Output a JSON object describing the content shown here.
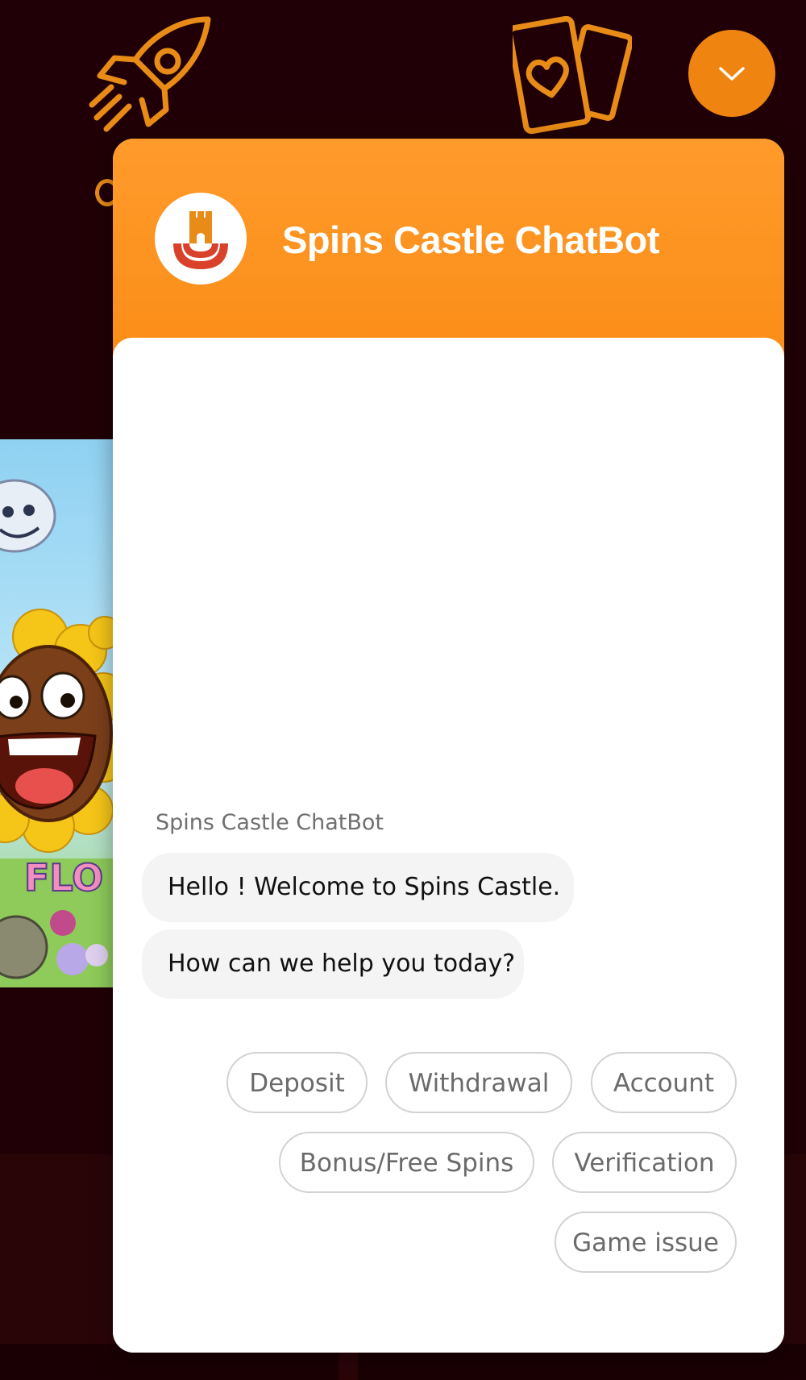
{
  "chat": {
    "title": "Spins Castle ChatBot",
    "sender_name": "Spins Castle ChatBot",
    "messages": [
      "Hello ! Welcome to Spins Castle.",
      "How can we help you today?"
    ],
    "quick_replies": [
      "Deposit",
      "Withdrawal",
      "Account",
      "Bonus/Free Spins",
      "Verification",
      "Game issue"
    ]
  },
  "colors": {
    "accent": "#fb8d17",
    "page_background": "#200006",
    "icon_outline": "#e88b17"
  },
  "icons": {
    "top_left": "rocket-icon",
    "top_right": "playing-cards-heart-icon",
    "toggle": "chevron-down-icon",
    "avatar": "castle-logo"
  }
}
